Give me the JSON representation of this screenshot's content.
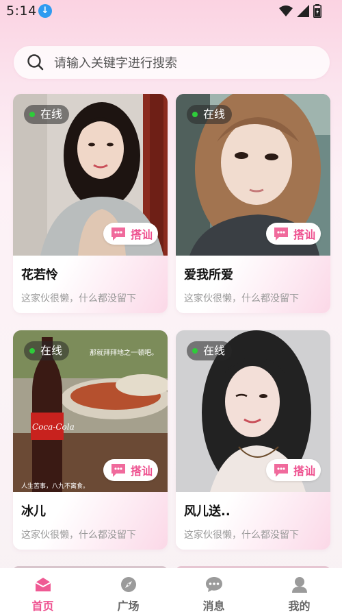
{
  "status_bar": {
    "time": "5:14",
    "download_icon": "download-arrow-icon"
  },
  "search": {
    "placeholder": "请输入关键字进行搜索",
    "icon": "search-icon"
  },
  "cards": [
    {
      "online_label": "在线",
      "chat_label": "搭讪",
      "name": "花若怜",
      "bio": "这家伙很懒，什么都没留下",
      "photo_palette": [
        "#8a2a1e",
        "#d8d2cc"
      ]
    },
    {
      "online_label": "在线",
      "chat_label": "搭讪",
      "name": "爱我所爱",
      "bio": "这家伙很懒，什么都没留下",
      "photo_palette": [
        "#6e8a86",
        "#3a3f44"
      ]
    },
    {
      "online_label": "在线",
      "chat_label": "搭讪",
      "name": "冰儿",
      "bio": "这家伙很懒，什么都没留下",
      "photo_caption_top": "那就拜拜地之一顿吧。",
      "photo_caption_bottom": "人生苦事，八九不离食。",
      "bottle_text": "Coca-Cola",
      "photo_palette": [
        "#a5a08d",
        "#3a1a14"
      ]
    },
    {
      "online_label": "在线",
      "chat_label": "搭讪",
      "name": "风儿送..",
      "bio": "这家伙很懒，什么都没留下",
      "photo_palette": [
        "#d9d9da",
        "#222222"
      ]
    }
  ],
  "bottom_nav": {
    "items": [
      {
        "label": "首页",
        "icon": "home-icon",
        "active": true
      },
      {
        "label": "广场",
        "icon": "compass-icon",
        "active": false
      },
      {
        "label": "消息",
        "icon": "message-icon",
        "active": false
      },
      {
        "label": "我的",
        "icon": "profile-icon",
        "active": false
      }
    ]
  },
  "colors": {
    "accent": "#ee4f8e",
    "online": "#2ecc3a",
    "bio_text": "#999999"
  }
}
